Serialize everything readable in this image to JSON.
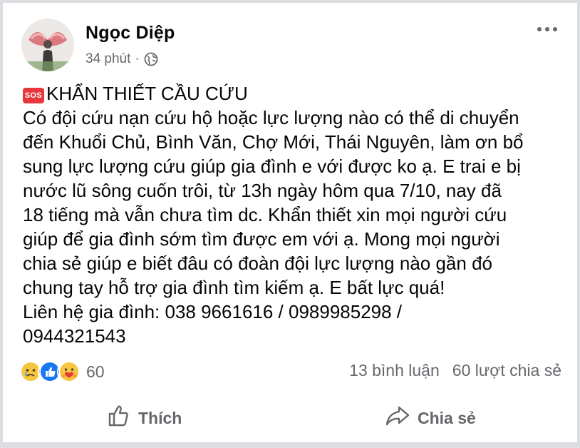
{
  "post": {
    "author": "Ngọc Diệp",
    "time": "34 phút",
    "separator": "·",
    "sos_badge": "SOS",
    "lines": [
      "KHẨN THIẾT CẦU CỨU",
      "Có đội cứu nạn cứu hộ hoặc lực lượng nào có thể di chuyển",
      "đến Khuổi Chủ, Bình Văn, Chợ Mới, Thái Nguyên, làm ơn bổ",
      "sung lực lượng cứu giúp gia đình e với được ko ạ. E trai e bị",
      "nước lũ sông cuốn trôi, từ 13h ngày hôm qua 7/10, nay đã",
      "18 tiếng mà vẫn chưa tìm dc. Khẩn thiết xin mọi người cứu",
      "giúp để gia đình sớm tìm được em với ạ. Mong mọi người",
      "chia sẻ giúp e biết đâu có đoàn đội lực lượng nào gần đó",
      "chung tay hỗ trợ gia đình tìm kiếm ạ. E bất lực quá!",
      "Liên hệ gia đình: 038 9661616 / 0989985298 /",
      "0944321543"
    ]
  },
  "stats": {
    "reaction_count": "60",
    "comments": "13 bình luận",
    "shares": "60 lượt chia sẻ"
  },
  "actions": {
    "like_label": "Thích",
    "share_label": "Chia sẻ"
  },
  "icons": {
    "more": "more-horizontal-icon",
    "audience": "globe-icon",
    "reactions": [
      "sad-reaction-icon",
      "like-reaction-icon",
      "care-reaction-icon"
    ],
    "like": "thumbs-up-icon",
    "share": "share-arrow-icon"
  },
  "colors": {
    "sos_red": "#e8363c",
    "like_blue": "#1877f2",
    "reaction_yellow": "#f7c63f",
    "secondary_text": "#65676b"
  }
}
